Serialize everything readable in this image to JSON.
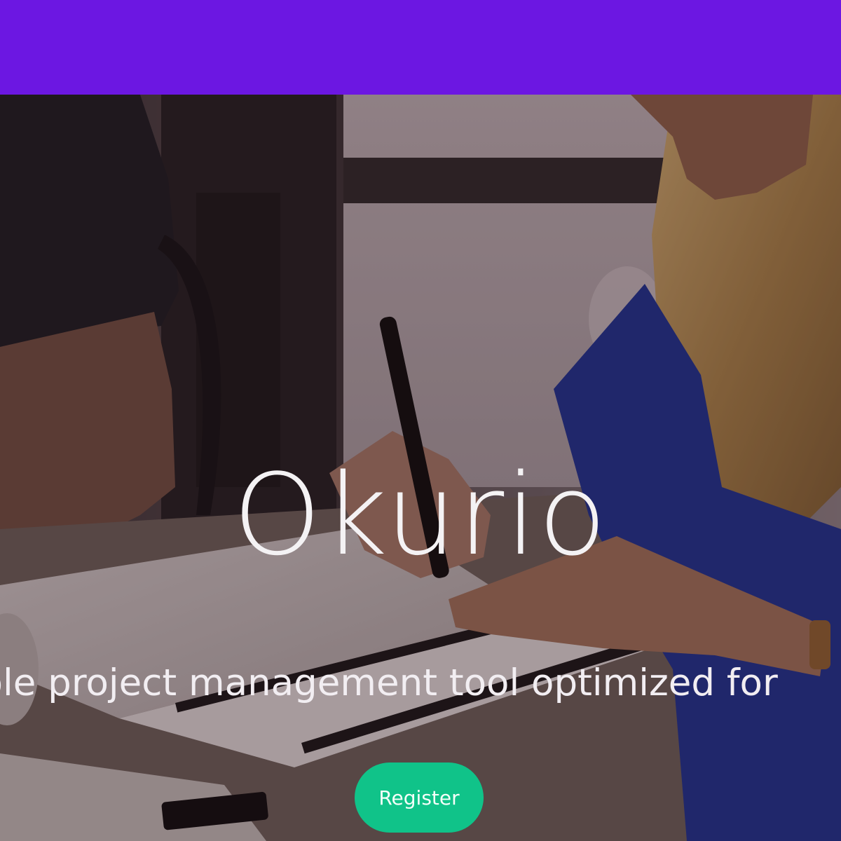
{
  "colors": {
    "topbar": "#6c17e2",
    "register_button": "#10c389",
    "hero_text": "#f4f2f4"
  },
  "hero": {
    "title": "Okurio",
    "tagline": "imple project management tool optimized for",
    "register_label": "Register"
  },
  "image": {
    "description_icon": "hero-photo-meeting"
  }
}
